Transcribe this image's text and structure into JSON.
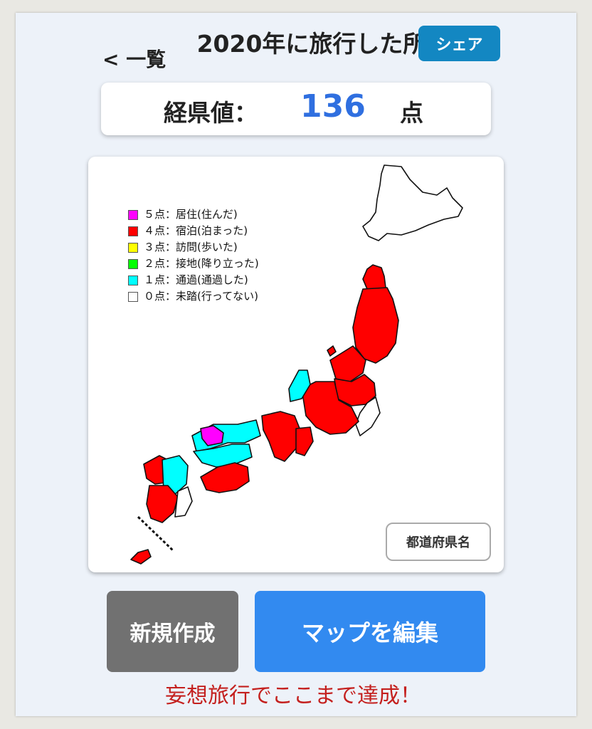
{
  "header": {
    "back_label": "< 一覧",
    "title": "2020年に旅行した所",
    "share_label": "シェア"
  },
  "score": {
    "label": "経県値：",
    "value": "136",
    "unit": "点"
  },
  "legend": [
    {
      "text": "５点：居住(住んだ)",
      "color": "#ff00ff"
    },
    {
      "text": "４点：宿泊(泊まった)",
      "color": "#ff0000"
    },
    {
      "text": "３点：訪問(歩いた)",
      "color": "#ffff00"
    },
    {
      "text": "２点：接地(降り立った)",
      "color": "#00ff00"
    },
    {
      "text": "１点：通過(通過した)",
      "color": "#00ffff"
    },
    {
      "text": "０点：未踏(行ってない)",
      "color": "#ffffff"
    }
  ],
  "map": {
    "pref_button_label": "都道府県名"
  },
  "actions": {
    "new_label": "新規作成",
    "edit_label": "マップを編集"
  },
  "caption": "妄想旅行でここまで達成！"
}
